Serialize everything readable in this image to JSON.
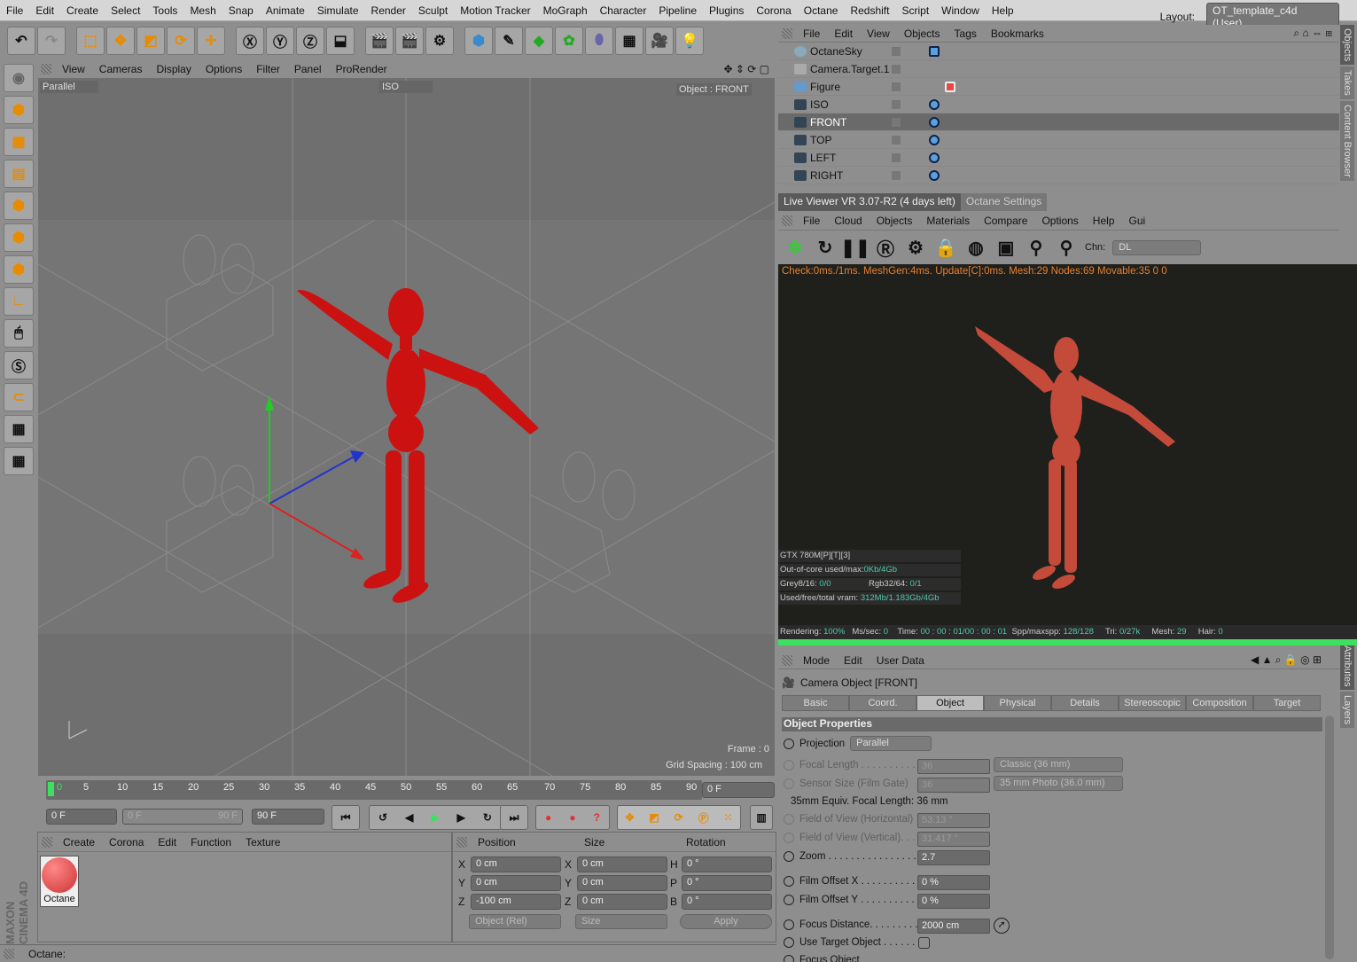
{
  "menu": [
    "File",
    "Edit",
    "Create",
    "Select",
    "Tools",
    "Mesh",
    "Snap",
    "Animate",
    "Simulate",
    "Render",
    "Sculpt",
    "Motion Tracker",
    "MoGraph",
    "Character",
    "Pipeline",
    "Plugins",
    "Corona",
    "Octane",
    "Redshift",
    "Script",
    "Window",
    "Help"
  ],
  "layout": {
    "label": "Layout:",
    "value": "OT_template_c4d (User)"
  },
  "viewport": {
    "menu": [
      "View",
      "Cameras",
      "Display",
      "Options",
      "Filter",
      "Panel",
      "ProRender"
    ],
    "projection": "Parallel",
    "camera_label": "ISO",
    "object_label": "Object : FRONT",
    "frame": "Frame : 0",
    "grid_spacing": "Grid Spacing : 100 cm"
  },
  "timeline": {
    "ticks": [
      "0",
      "5",
      "10",
      "15",
      "20",
      "25",
      "30",
      "35",
      "40",
      "45",
      "50",
      "55",
      "60",
      "65",
      "70",
      "75",
      "80",
      "85",
      "90"
    ],
    "current": "0 F",
    "start": "0 F",
    "range_start": "0 F",
    "range_end": "90 F",
    "end": "90 F"
  },
  "material_manager": {
    "menu": [
      "Create",
      "Corona",
      "Edit",
      "Function",
      "Texture"
    ],
    "materials": [
      {
        "name": "Octane",
        "color": "#e05050"
      }
    ]
  },
  "coordinates": {
    "headers": [
      "Position",
      "Size",
      "Rotation"
    ],
    "rows": [
      {
        "a": "X",
        "p": "0 cm",
        "b": "X",
        "s": "0 cm",
        "c": "H",
        "r": "0 °"
      },
      {
        "a": "Y",
        "p": "0 cm",
        "b": "Y",
        "s": "0 cm",
        "c": "P",
        "r": "0 °"
      },
      {
        "a": "Z",
        "p": "-100 cm",
        "b": "Z",
        "s": "0 cm",
        "c": "B",
        "r": "0 °"
      }
    ],
    "mode": "Object (Rel)",
    "size_mode": "Size",
    "apply": "Apply"
  },
  "status": "Octane:",
  "brand": "MAXON CINEMA 4D",
  "object_manager": {
    "menu": [
      "File",
      "Edit",
      "View",
      "Objects",
      "Tags",
      "Bookmarks"
    ],
    "objects": [
      "OctaneSky",
      "Camera.Target.1",
      "Figure",
      "ISO",
      "FRONT",
      "TOP",
      "LEFT",
      "RIGHT"
    ],
    "selected": "FRONT"
  },
  "side_tabs": [
    "Objects",
    "Takes",
    "Content Browser",
    "Attributes",
    "Layers"
  ],
  "octane": {
    "tabs": [
      "Live Viewer VR 3.07-R2 (4 days left)",
      "Octane Settings"
    ],
    "menu": [
      "File",
      "Cloud",
      "Objects",
      "Materials",
      "Compare",
      "Options",
      "Help",
      "Gui"
    ],
    "channel_label": "Chn:",
    "channel": "DL",
    "check": "Check:0ms./1ms. MeshGen:4ms. Update[C]:0ms. Mesh:29 Nodes:69 Movable:35  0 0",
    "gpu": "GTX 780M[P][T][3]",
    "ooc_label": "Out-of-core used/max:",
    "ooc": "0Kb/4Gb",
    "grey_label": "Grey8/16:",
    "grey": "0/0",
    "rgb_label": "Rgb32/64:",
    "rgb": "0/1",
    "vram_label": "Used/free/total vram:",
    "vram": "312Mb/1.183Gb/4Gb",
    "rendering_label": "Rendering:",
    "rendering": "100%",
    "ms_label": "Ms/sec:",
    "ms": "0",
    "time_label": "Time:",
    "time": "00 : 00 : 01/00 : 00 : 01",
    "spp_label": "Spp/maxspp:",
    "spp": "128/128",
    "tri_label": "Tri:",
    "tri": "0/27k",
    "mesh_label": "Mesh:",
    "mesh": "29",
    "hair_label": "Hair:",
    "hair": "0",
    "progress": 100
  },
  "attributes": {
    "menu": [
      "Mode",
      "Edit",
      "User Data"
    ],
    "title": "Camera Object [FRONT]",
    "tabs": [
      "Basic",
      "Coord.",
      "Object",
      "Physical",
      "Details",
      "Stereoscopic",
      "Composition",
      "Target"
    ],
    "active_tab": "Object",
    "section": "Object Properties",
    "projection_label": "Projection",
    "projection": "Parallel",
    "focal_label": "Focal Length . . . . . . . . . . .",
    "focal": "36",
    "focal_preset": "Classic (36 mm)",
    "sensor_label": "Sensor Size (Film Gate)",
    "sensor": "36",
    "sensor_preset": "35 mm Photo (36.0 mm)",
    "equiv_label": "35mm Equiv. Focal Length:",
    "equiv": "36 mm",
    "fovh_label": "Field of View (Horizontal)",
    "fovh": "53.13 °",
    "fovv_label": "Field of View (Vertical). . .",
    "fovv": "31.417 °",
    "zoom_label": "Zoom . . . . . . . . . . . . . . . .",
    "zoom": "2.7",
    "fox_label": "Film Offset X . . . . . . . . . .",
    "fox": "0 %",
    "foy_label": "Film Offset Y . . . . . . . . . .",
    "foy": "0 %",
    "focus_label": "Focus Distance. . . . . . . . .",
    "focus": "2000 cm",
    "target_label": "Use Target Object . . . . . .",
    "focus_obj_label": "Focus Object"
  }
}
